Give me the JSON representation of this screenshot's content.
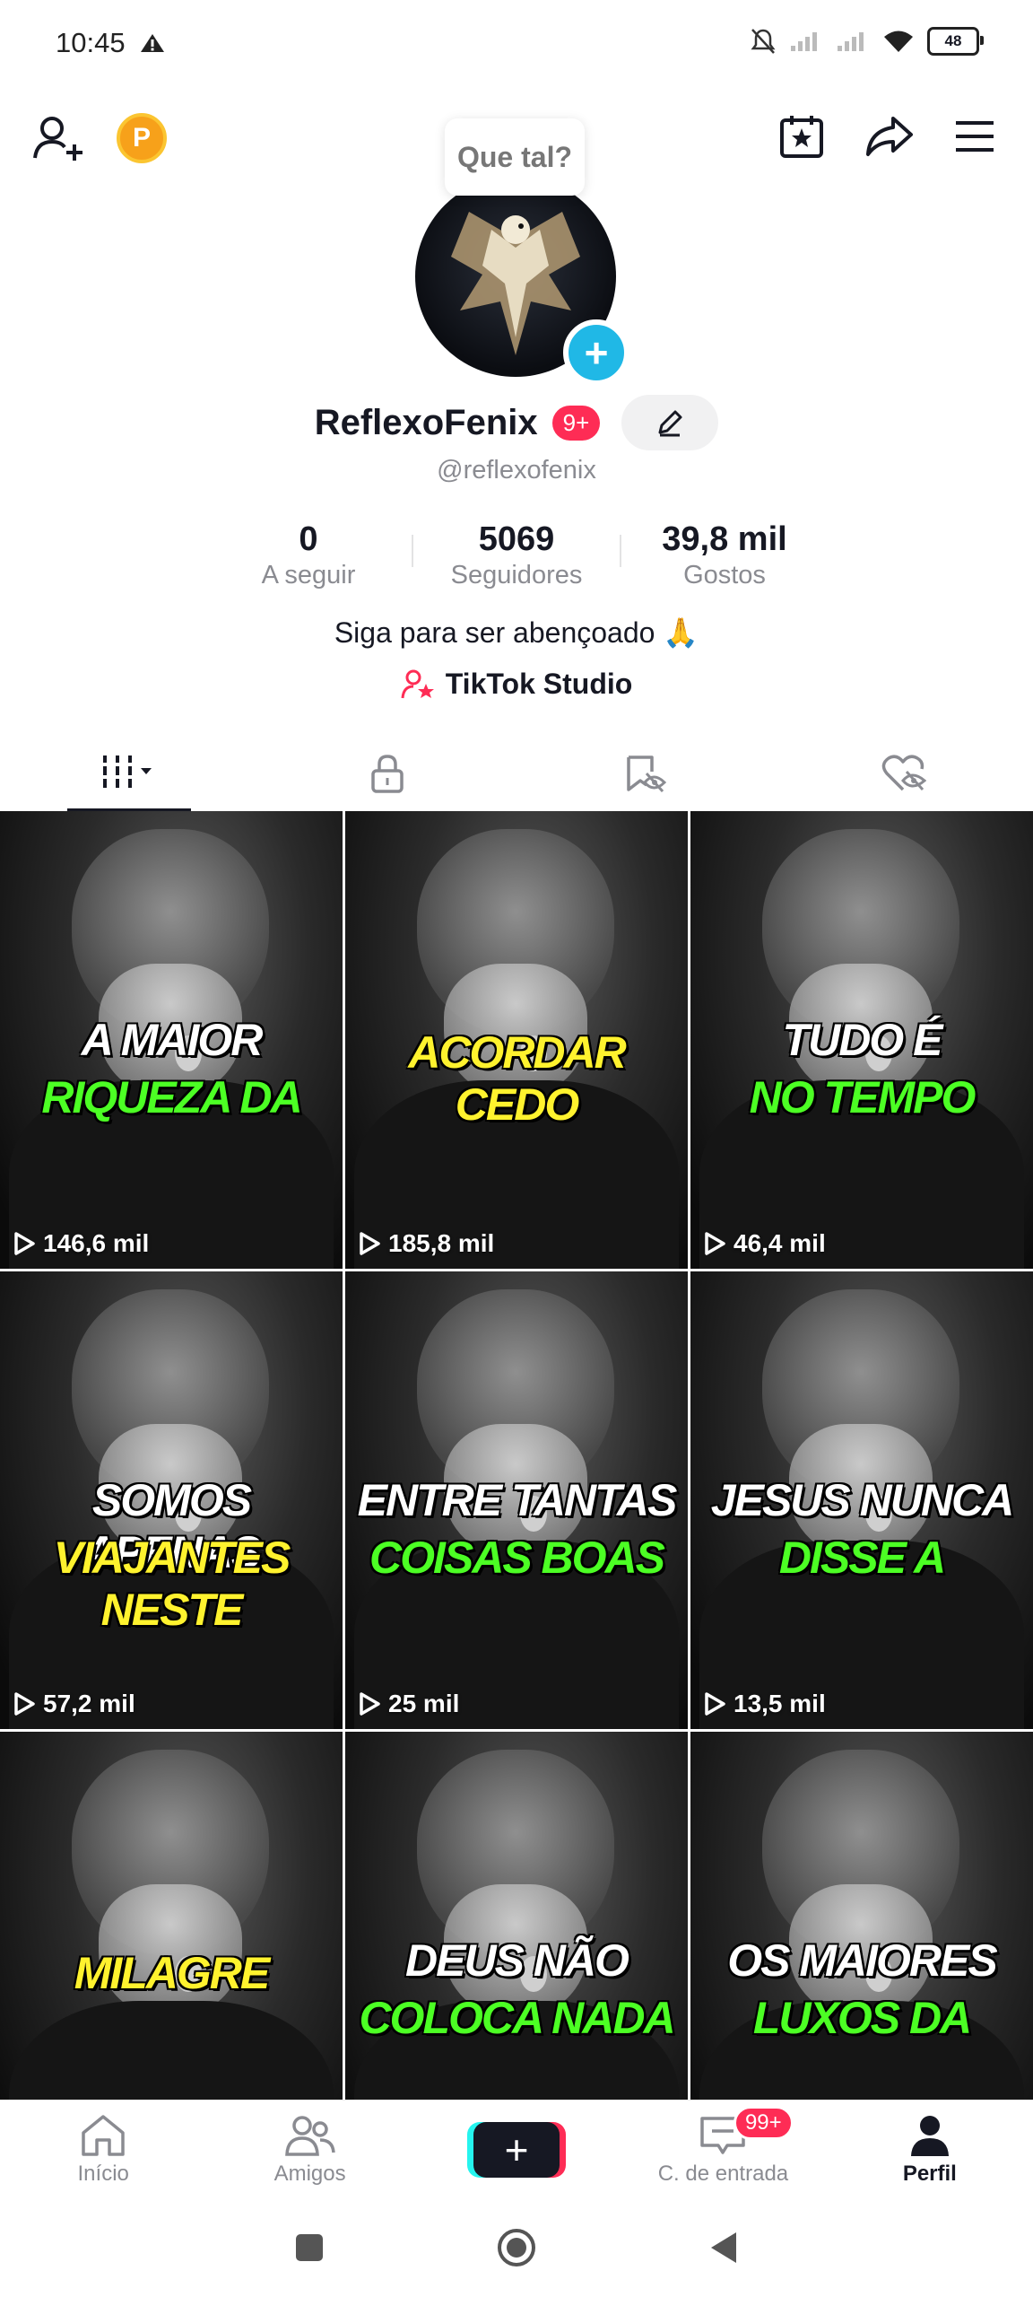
{
  "status_bar": {
    "time": "10:45",
    "battery": "48"
  },
  "top_bar": {
    "coin_label": "P",
    "tooltip": "Que tal?"
  },
  "profile": {
    "username": "ReflexoFenix",
    "notif_badge": "9+",
    "handle": "@reflexofenix",
    "stats": [
      {
        "value": "0",
        "label": "A seguir"
      },
      {
        "value": "5069",
        "label": "Seguidores"
      },
      {
        "value": "39,8 mil",
        "label": "Gostos"
      }
    ],
    "bio": "Siga para ser abençoado 🙏",
    "studio_link": "TikTok Studio"
  },
  "videos": [
    {
      "line1": "A MAIOR",
      "line2": "RIQUEZA DA",
      "c1": "w",
      "c2": "g",
      "views": "146,6 mil"
    },
    {
      "line1": "",
      "line2": "ACORDAR CEDO",
      "c1": "w",
      "c2": "y",
      "views": "185,8 mil"
    },
    {
      "line1": "TUDO É",
      "line2": "NO TEMPO",
      "c1": "w",
      "c2": "g",
      "views": "46,4 mil"
    },
    {
      "line1": "SOMOS APENAS",
      "line2": "VIAJANTES NESTE",
      "c1": "w",
      "c2": "y",
      "views": "57,2 mil"
    },
    {
      "line1": "ENTRE TANTAS",
      "line2": "COISAS BOAS",
      "c1": "w",
      "c2": "g",
      "views": "25 mil"
    },
    {
      "line1": "JESUS NUNCA",
      "line2": "DISSE A",
      "c1": "w",
      "c2": "g",
      "views": "13,5 mil"
    },
    {
      "line1": "",
      "line2": "MILAGRE",
      "c1": "w",
      "c2": "y",
      "views": ""
    },
    {
      "line1": "DEUS NÃO",
      "line2": "COLOCA NADA",
      "c1": "w",
      "c2": "g",
      "views": ""
    },
    {
      "line1": "OS MAIORES",
      "line2": "LUXOS DA",
      "c1": "w",
      "c2": "g",
      "views": ""
    }
  ],
  "bottom_nav": {
    "home": "Início",
    "friends": "Amigos",
    "create": "+",
    "inbox": "C. de entrada",
    "inbox_badge": "99+",
    "profile": "Perfil"
  },
  "colors": {
    "accent": "#fe2c55",
    "cyan": "#25f4ee",
    "caption_green": "#4cff24",
    "caption_yellow": "#fff22e"
  }
}
